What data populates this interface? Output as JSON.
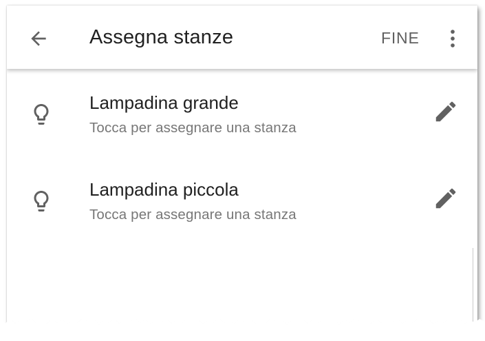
{
  "appbar": {
    "back_icon": "arrow-back-icon",
    "title": "Assegna stanze",
    "done_label": "FINE",
    "more_icon": "more-vert-icon"
  },
  "devices": [
    {
      "icon": "lightbulb-outline-icon",
      "name": "Lampadina grande",
      "subtitle": "Tocca per assegnare una stanza",
      "action_icon": "edit-pencil-icon"
    },
    {
      "icon": "lightbulb-outline-icon",
      "name": "Lampadina piccola",
      "subtitle": "Tocca per assegnare una stanza",
      "action_icon": "edit-pencil-icon"
    }
  ],
  "colors": {
    "title_text": "#212121",
    "secondary_text": "#777777",
    "icon": "#616161",
    "background": "#ffffff"
  }
}
